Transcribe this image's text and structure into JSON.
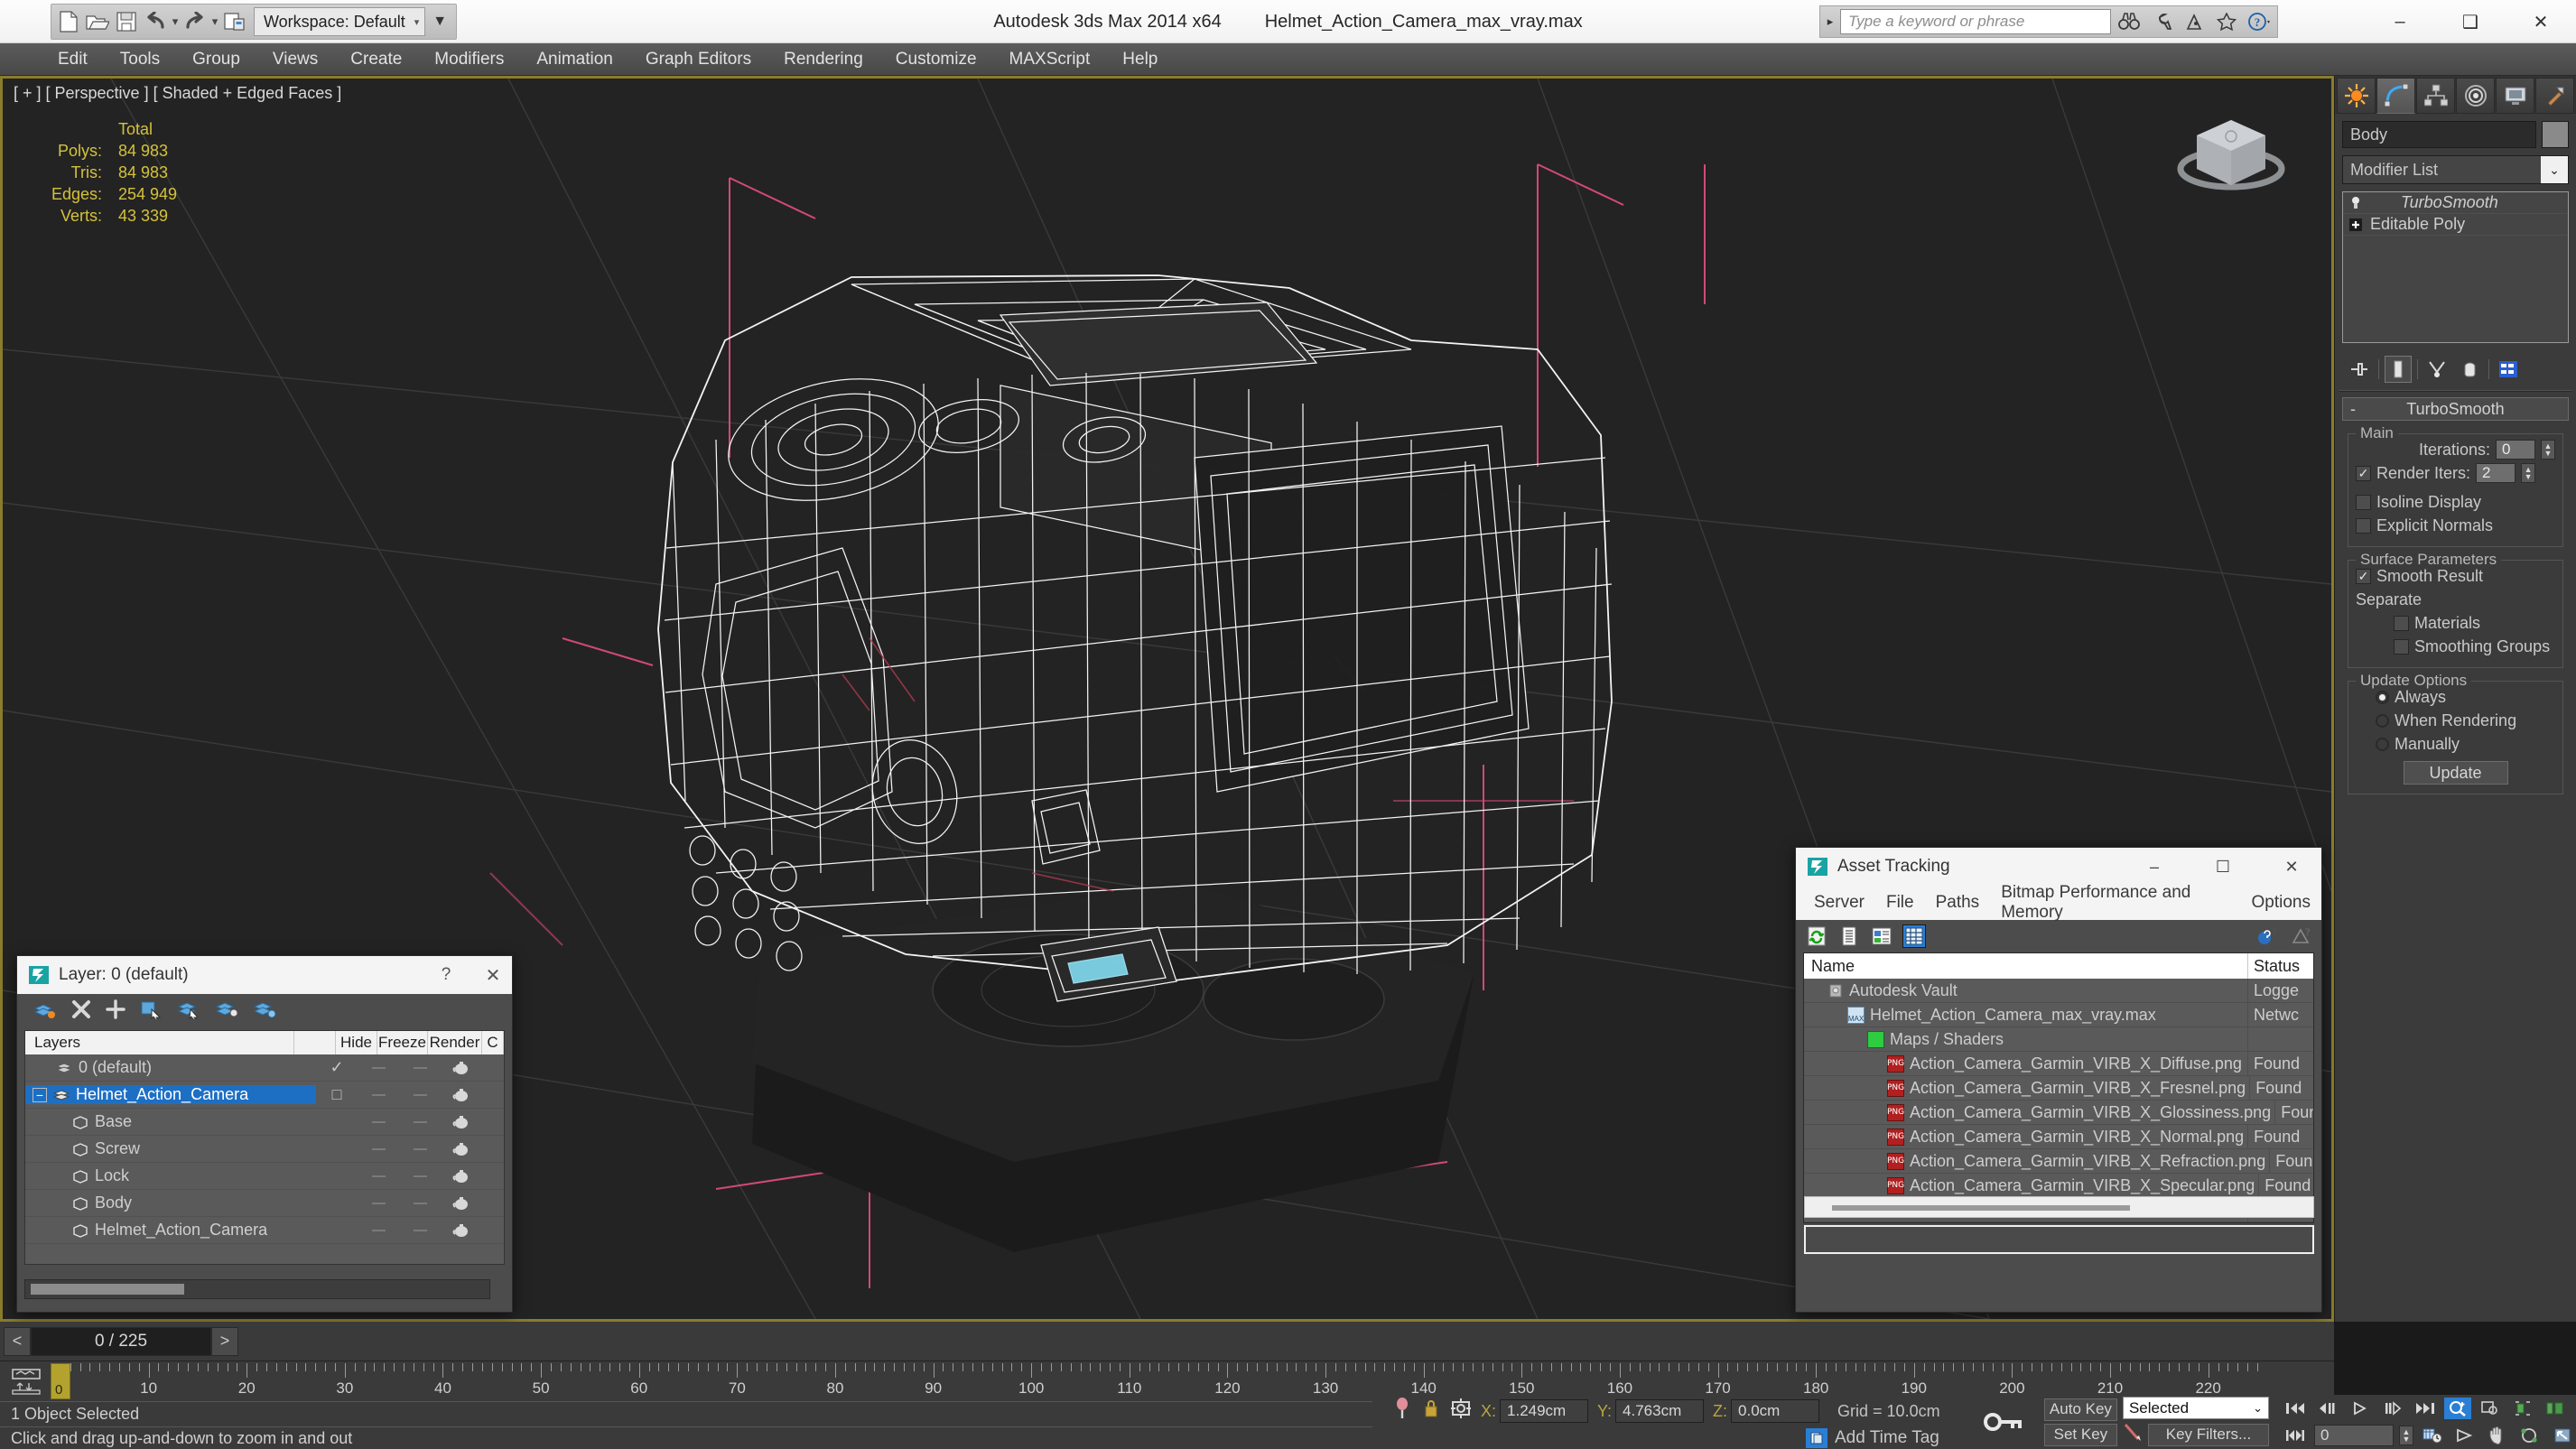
{
  "app": {
    "title": "Autodesk 3ds Max  2014 x64",
    "document": "Helmet_Action_Camera_max_vray.max",
    "workspace_label": "Workspace: Default"
  },
  "quick_access": {
    "icons": [
      "new-file-icon",
      "open-file-icon",
      "save-icon",
      "undo-icon",
      "redo-icon",
      "set-project-folder-icon"
    ]
  },
  "search": {
    "placeholder": "Type a keyword or phrase",
    "icons": [
      "search-binoculars-icon",
      "wrench-icon",
      "satellite-icon",
      "favorites-star-icon",
      "help-question-icon"
    ]
  },
  "window_buttons": {
    "minimize": "–",
    "maximize": "❑",
    "close": "✕"
  },
  "menu": {
    "items": [
      "Edit",
      "Tools",
      "Group",
      "Views",
      "Create",
      "Modifiers",
      "Animation",
      "Graph Editors",
      "Rendering",
      "Customize",
      "MAXScript",
      "Help"
    ]
  },
  "viewport": {
    "label": "[ + ] [ Perspective ] [ Shaded + Edged Faces ]",
    "stats_header": "Total",
    "stats": [
      {
        "label": "Polys:",
        "value": "84 983"
      },
      {
        "label": "Tris:",
        "value": "84 983"
      },
      {
        "label": "Edges:",
        "value": "254 949"
      },
      {
        "label": "Verts:",
        "value": "43 339"
      }
    ],
    "stats_color": "#d4c23a",
    "border_color": "#8a7c2a",
    "background": "#232323"
  },
  "command_panel": {
    "tabs": [
      "create-tab",
      "modify-tab",
      "hierarchy-tab",
      "motion-tab",
      "display-tab",
      "utilities-tab"
    ],
    "active_tab_index": 1,
    "object_name": "Body",
    "modifier_list_label": "Modifier List",
    "modifier_stack": [
      {
        "name": "TurboSmooth",
        "italic": true,
        "icon": "lightbulb-icon"
      },
      {
        "name": "Editable Poly",
        "italic": false,
        "icon": "plus-box-icon"
      }
    ],
    "stack_tools": [
      "pin-stack-icon",
      "show-end-result-icon",
      "make-unique-icon",
      "remove-modifier-icon",
      "configure-modifier-sets-icon"
    ],
    "rollout": {
      "title": "TurboSmooth",
      "collapse_glyph": "-",
      "groups": [
        {
          "label": "Main",
          "rows": [
            {
              "type": "spinner",
              "label": "Iterations:",
              "value": "0"
            },
            {
              "type": "check_spinner",
              "label": "Render Iters:",
              "value": "2",
              "checked": true
            },
            {
              "type": "checkbox",
              "label": "Isoline Display",
              "checked": false
            },
            {
              "type": "checkbox",
              "label": "Explicit Normals",
              "checked": false
            }
          ]
        },
        {
          "label": "Surface Parameters",
          "rows": [
            {
              "type": "checkbox",
              "label": "Smooth Result",
              "checked": true
            },
            {
              "type": "text",
              "label": "Separate"
            },
            {
              "type": "checkbox_indent",
              "label": "Materials",
              "checked": false
            },
            {
              "type": "checkbox_indent",
              "label": "Smoothing Groups",
              "checked": false
            }
          ]
        },
        {
          "label": "Update Options",
          "rows": [
            {
              "type": "radio",
              "label": "Always",
              "checked": true
            },
            {
              "type": "radio",
              "label": "When Rendering",
              "checked": false
            },
            {
              "type": "radio",
              "label": "Manually",
              "checked": false
            },
            {
              "type": "button",
              "label": "Update"
            }
          ]
        }
      ]
    }
  },
  "layer_dialog": {
    "title": "Layer: 0 (default)",
    "help_glyph": "?",
    "close_glyph": "✕",
    "toolbar_icons": [
      "create-new-layer-icon",
      "delete-layer-icon",
      "add-layer-icon",
      "select-objects-in-layer-icon",
      "select-highlighted-objects-icon",
      "highlight-selected-objects-icon",
      "layer-properties-icon"
    ],
    "columns": [
      "Layers",
      "",
      "Hide",
      "Freeze",
      "Render",
      "C"
    ],
    "rows": [
      {
        "name": "0 (default)",
        "icon": "layer-icon",
        "indent": 1,
        "hide": "✓",
        "freeze": "—",
        "render": "teapot-icon",
        "selected": false,
        "expander": ""
      },
      {
        "name": "Helmet_Action_Camera",
        "icon": "layer-icon",
        "indent": 0,
        "hide": "□",
        "freeze": "—",
        "render": "teapot-icon",
        "selected": true,
        "expander": "−"
      },
      {
        "name": "Base",
        "icon": "object-icon",
        "indent": 2,
        "hide": "",
        "freeze": "—",
        "render": "teapot-icon",
        "selected": false,
        "expander": ""
      },
      {
        "name": "Screw",
        "icon": "object-icon",
        "indent": 2,
        "hide": "",
        "freeze": "—",
        "render": "teapot-icon",
        "selected": false,
        "expander": ""
      },
      {
        "name": "Lock",
        "icon": "object-icon",
        "indent": 2,
        "hide": "",
        "freeze": "—",
        "render": "teapot-icon",
        "selected": false,
        "expander": ""
      },
      {
        "name": "Body",
        "icon": "object-icon",
        "indent": 2,
        "hide": "",
        "freeze": "—",
        "render": "teapot-icon",
        "selected": false,
        "expander": ""
      },
      {
        "name": "Helmet_Action_Camera",
        "icon": "object-icon",
        "indent": 2,
        "hide": "",
        "freeze": "—",
        "render": "teapot-icon",
        "selected": false,
        "expander": ""
      }
    ]
  },
  "asset_dialog": {
    "title": "Asset Tracking",
    "window_buttons": {
      "minimize": "–",
      "maximize": "☐",
      "close": "✕"
    },
    "menu": [
      "Server",
      "File",
      "Paths",
      "Bitmap Performance and Memory",
      "Options"
    ],
    "toolbar_icons": [
      "refresh-icon",
      "list-view-icon",
      "details-view-icon",
      "grid-view-icon"
    ],
    "toolbar_right_icons": [
      "help-web-icon",
      "help-icon"
    ],
    "active_toolbar_index": 3,
    "columns": [
      "Name",
      "Status"
    ],
    "rows": [
      {
        "name": "Autodesk Vault",
        "status": "Logge",
        "icon": "vault-icon",
        "indent": 1
      },
      {
        "name": "Helmet_Action_Camera_max_vray.max",
        "status": "Netwc",
        "icon": "max-file-icon",
        "indent": 2
      },
      {
        "name": "Maps / Shaders",
        "status": "",
        "icon": "maps-shaders-icon",
        "indent": 3
      },
      {
        "name": "Action_Camera_Garmin_VIRB_X_Diffuse.png",
        "status": "Found",
        "icon": "png-icon",
        "indent": 4
      },
      {
        "name": "Action_Camera_Garmin_VIRB_X_Fresnel.png",
        "status": "Found",
        "icon": "png-icon",
        "indent": 4
      },
      {
        "name": "Action_Camera_Garmin_VIRB_X_Glossiness.png",
        "status": "Found",
        "icon": "png-icon",
        "indent": 4
      },
      {
        "name": "Action_Camera_Garmin_VIRB_X_Normal.png",
        "status": "Found",
        "icon": "png-icon",
        "indent": 4
      },
      {
        "name": "Action_Camera_Garmin_VIRB_X_Refraction.png",
        "status": "Found",
        "icon": "png-icon",
        "indent": 4
      },
      {
        "name": "Action_Camera_Garmin_VIRB_X_Specular.png",
        "status": "Found",
        "icon": "png-icon",
        "indent": 4
      }
    ]
  },
  "timeline": {
    "current_frame_display": "0 / 225",
    "prev_glyph": "<",
    "next_glyph": ">",
    "tick_labels": [
      "0",
      "10",
      "20",
      "30",
      "40",
      "50",
      "60",
      "70",
      "80",
      "90",
      "100",
      "110",
      "120",
      "130",
      "140",
      "150",
      "160",
      "170",
      "180",
      "190",
      "200",
      "210",
      "220"
    ],
    "slider_label": "0",
    "range_start": 0,
    "range_end": 225
  },
  "status_bar": {
    "line1": "1 Object Selected",
    "line2": "Click and drag up-and-down to zoom in and out",
    "coords": [
      {
        "label": "X:",
        "value": "1.249cm"
      },
      {
        "label": "Y:",
        "value": "4.763cm"
      },
      {
        "label": "Z:",
        "value": "0.0cm"
      }
    ],
    "grid": "Grid = 10.0cm",
    "add_time_tag": "Add Time Tag",
    "icons": [
      "pin-icon",
      "lock-selection-icon",
      "absolute-relative-icon"
    ]
  },
  "animation_controls": {
    "auto_key": "Auto Key",
    "set_key": "Set Key",
    "selection_filter": "Selected",
    "key_filters": "Key Filters...",
    "current_frame": "0",
    "key_icon": "set-key-icon",
    "playback_icons": [
      "go-to-start-icon",
      "previous-frame-icon",
      "play-animation-icon",
      "next-frame-icon",
      "go-to-end-icon",
      "zoom-region-icon",
      "zoom-extents-icon",
      "zoom-extents-all-icon",
      "maximize-viewport-icon"
    ],
    "playback_icons_row2": [
      "key-mode-toggle-icon",
      "time-configuration-icon",
      "field-of-view-icon",
      "pan-view-icon",
      "orbit-icon",
      "maximize-viewport-toggle-icon"
    ]
  }
}
